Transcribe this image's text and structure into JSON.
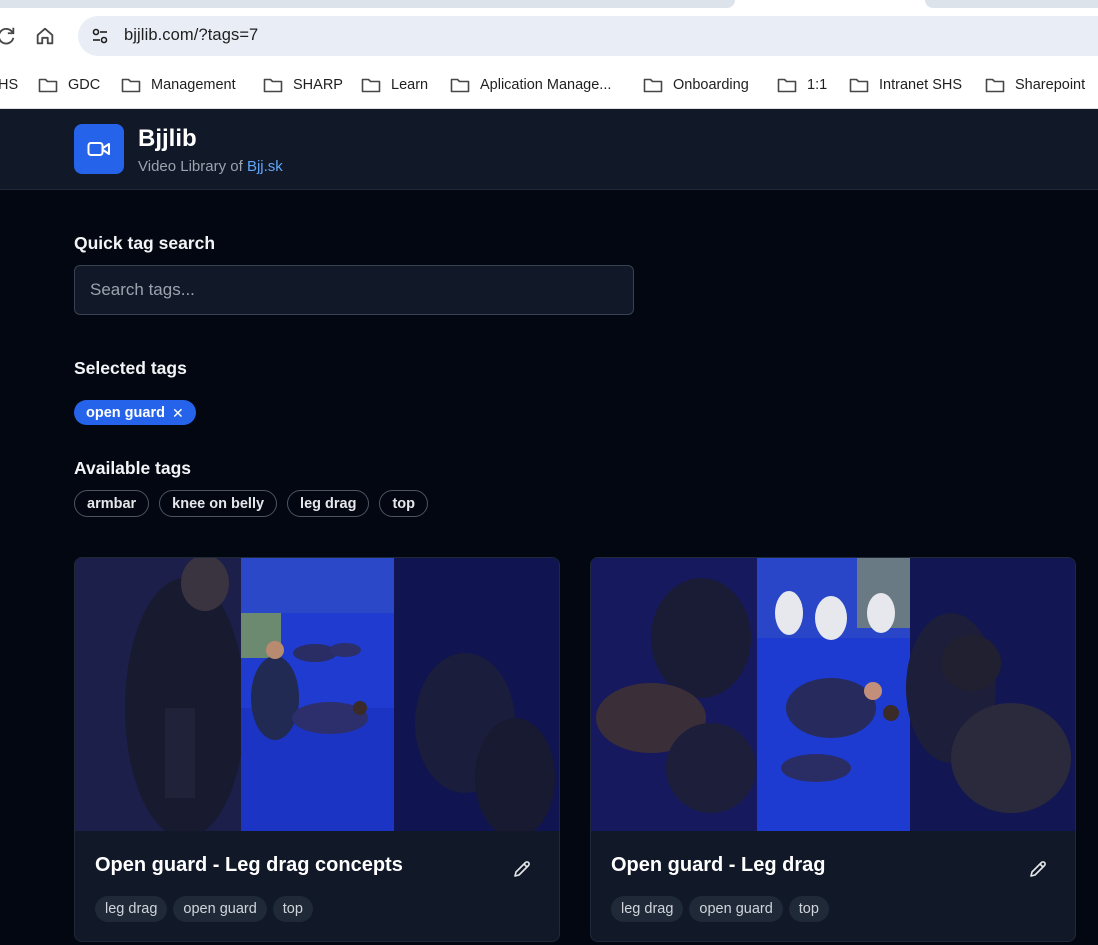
{
  "browser": {
    "url": "bjjlib.com/?tags=7",
    "bookmarks": [
      {
        "label": "HS"
      },
      {
        "label": "GDC"
      },
      {
        "label": "Management"
      },
      {
        "label": "SHARP"
      },
      {
        "label": "Learn"
      },
      {
        "label": "Aplication Manage..."
      },
      {
        "label": "Onboarding"
      },
      {
        "label": "1:1"
      },
      {
        "label": "Intranet SHS"
      },
      {
        "label": "Sharepoint"
      }
    ]
  },
  "header": {
    "title": "Bjjlib",
    "subtitle_prefix": "Video Library of ",
    "subtitle_link": "Bjj.sk"
  },
  "search": {
    "label": "Quick tag search",
    "placeholder": "Search tags..."
  },
  "selected": {
    "label": "Selected tags",
    "tags": [
      {
        "name": "open guard",
        "remove": "✕"
      }
    ]
  },
  "available": {
    "label": "Available tags",
    "tags": [
      "armbar",
      "knee on belly",
      "leg drag",
      "top"
    ]
  },
  "videos": [
    {
      "title": "Open guard - Leg drag concepts",
      "tags": [
        "leg drag",
        "open guard",
        "top"
      ]
    },
    {
      "title": "Open guard - Leg drag",
      "tags": [
        "leg drag",
        "open guard",
        "top"
      ]
    }
  ],
  "colors": {
    "accent": "#2563eb",
    "background": "#030712",
    "surface": "#111827",
    "mat": "#1a2fc0"
  },
  "icons": {
    "logo": "video-camera-icon",
    "edit": "pencil-icon",
    "remove": "close-icon"
  }
}
